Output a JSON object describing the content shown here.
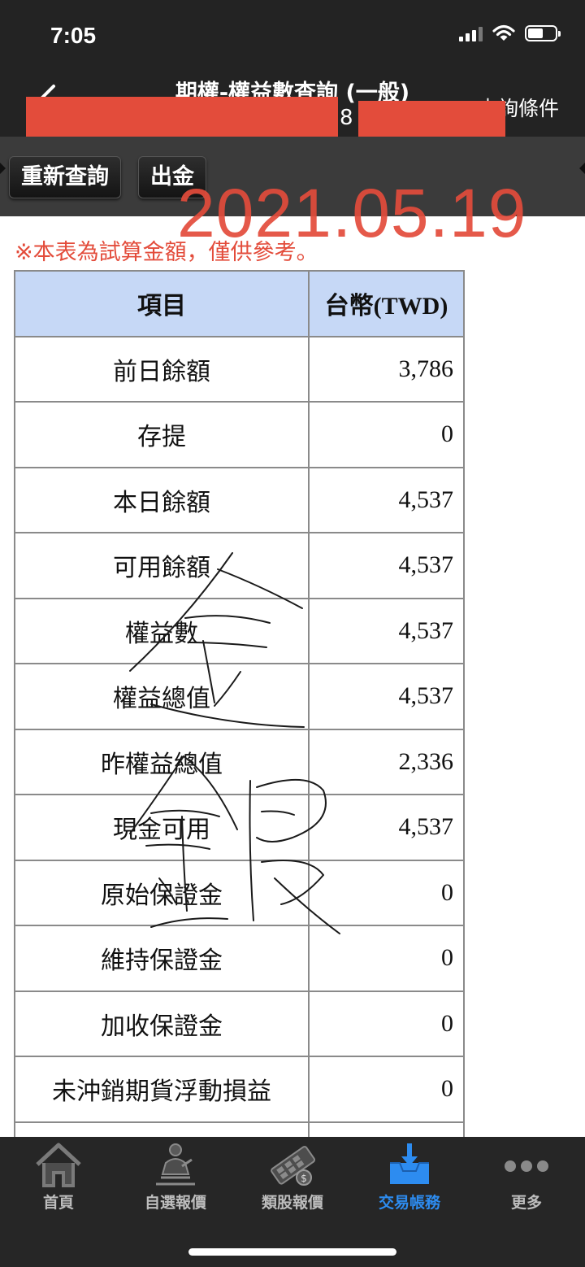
{
  "status_bar": {
    "time": "7:05",
    "battery_level": 0.55
  },
  "nav": {
    "title": "期權-權益數查詢 (一般)",
    "subtitle_fragment": "8",
    "query_conditions": "查詢條件"
  },
  "toolbar": {
    "requery_label": "重新查詢",
    "withdraw_label": "出金"
  },
  "overlay": {
    "date_stamp": "2021.05.19",
    "handwritten_text": "全銀",
    "stamp_color": "#e34c3b"
  },
  "notice": "※本表為試算金額，僅供參考。",
  "table": {
    "headers": [
      "項目",
      "台幣(TWD)"
    ],
    "rows": [
      {
        "item": "前日餘額",
        "value": "3,786"
      },
      {
        "item": "存提",
        "value": "0"
      },
      {
        "item": "本日餘額",
        "value": "4,537"
      },
      {
        "item": "可用餘額",
        "value": "4,537"
      },
      {
        "item": "權益數",
        "value": "4,537"
      },
      {
        "item": "權益總值",
        "value": "4,537"
      },
      {
        "item": "昨權益總值",
        "value": "2,336"
      },
      {
        "item": "現金可用",
        "value": "4,537"
      },
      {
        "item": "原始保證金",
        "value": "0"
      },
      {
        "item": "維持保證金",
        "value": "0"
      },
      {
        "item": "加收保證金",
        "value": "0"
      },
      {
        "item": "未沖銷期貨浮動損益",
        "value": "0"
      },
      {
        "item": "",
        "value": ""
      }
    ]
  },
  "tabs": [
    {
      "label": "首頁",
      "icon": "home-icon"
    },
    {
      "label": "自選報價",
      "icon": "person-chart-icon"
    },
    {
      "label": "類股報價",
      "icon": "film-money-icon"
    },
    {
      "label": "交易帳務",
      "icon": "inbox-download-icon",
      "active": true
    },
    {
      "label": "更多",
      "icon": "more-dots-icon"
    }
  ],
  "colors": {
    "header_bg": "#c6d8f6",
    "accent": "#2d8cf0",
    "bar_bg": "#232323"
  }
}
